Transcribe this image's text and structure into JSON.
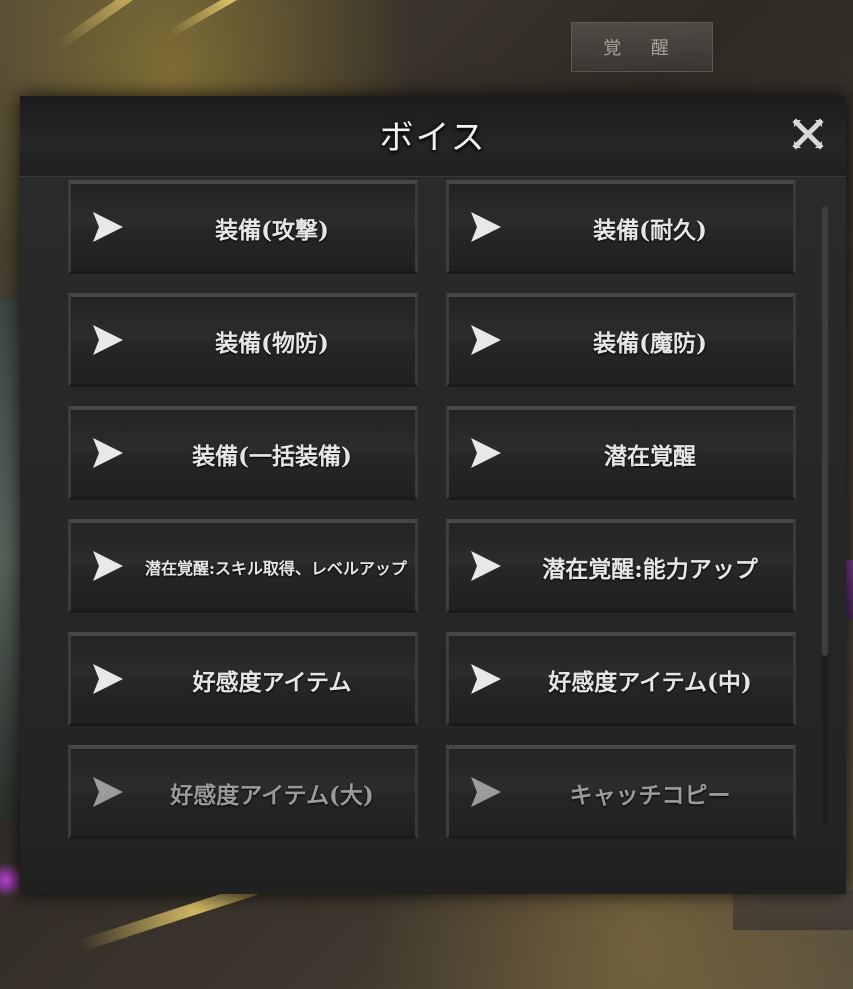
{
  "background": {
    "top_button_label": "覚 醒"
  },
  "dialog": {
    "title": "ボイス",
    "close_icon": "close-x-icon"
  },
  "voice_items": [
    {
      "label": "装備(攻撃)",
      "dim": false,
      "small": false
    },
    {
      "label": "装備(耐久)",
      "dim": false,
      "small": false
    },
    {
      "label": "装備(物防)",
      "dim": false,
      "small": false
    },
    {
      "label": "装備(魔防)",
      "dim": false,
      "small": false
    },
    {
      "label": "装備(一括装備)",
      "dim": false,
      "small": false
    },
    {
      "label": "潜在覚醒",
      "dim": false,
      "small": false
    },
    {
      "label": "潜在覚醒:スキル取得、レベルアップ",
      "dim": false,
      "small": true
    },
    {
      "label": "潜在覚醒:能力アップ",
      "dim": false,
      "small": false
    },
    {
      "label": "好感度アイテム",
      "dim": false,
      "small": false
    },
    {
      "label": "好感度アイテム(中)",
      "dim": false,
      "small": false
    },
    {
      "label": "好感度アイテム(大)",
      "dim": true,
      "small": false
    },
    {
      "label": "キャッチコピー",
      "dim": true,
      "small": false
    }
  ],
  "colors": {
    "panel": "#262626",
    "text": "#e6e6e6",
    "dim_text": "#9a9a9a"
  }
}
